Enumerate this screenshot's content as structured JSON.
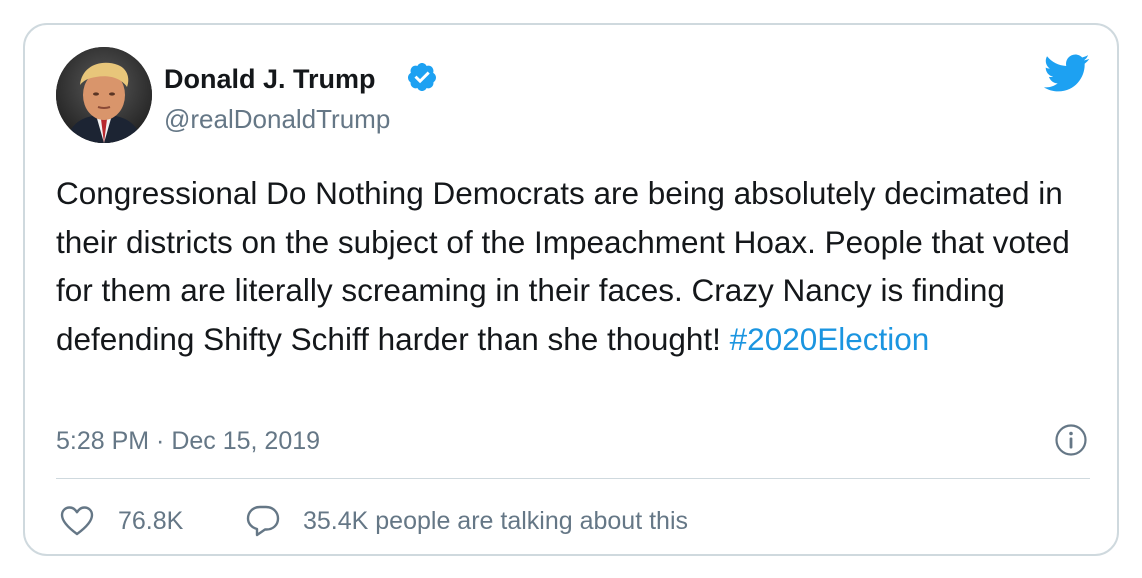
{
  "author": {
    "display_name": "Donald J. Trump",
    "handle": "@realDonaldTrump",
    "verified": true
  },
  "tweet": {
    "text": "Congressional Do Nothing Democrats are being absolutely decimated in their districts on the subject of the Impeachment Hoax. People that voted for them are literally screaming in their faces. Crazy Nancy is finding defending Shifty Schiff harder than she thought!",
    "hashtag": "#2020Election",
    "timestamp": "5:28 PM · Dec 15, 2019"
  },
  "engagement": {
    "likes": "76.8K",
    "conversation": "35.4K people are talking about this"
  },
  "icons": {
    "brand": "twitter-bird-icon",
    "verified": "verified-badge-icon",
    "info": "info-icon",
    "like": "heart-icon",
    "reply": "speech-bubble-icon"
  },
  "colors": {
    "text": "#14171a",
    "secondary": "#657786",
    "accent": "#1b95e0",
    "twitter_blue": "#1da1f2",
    "border": "#cfd9de"
  }
}
